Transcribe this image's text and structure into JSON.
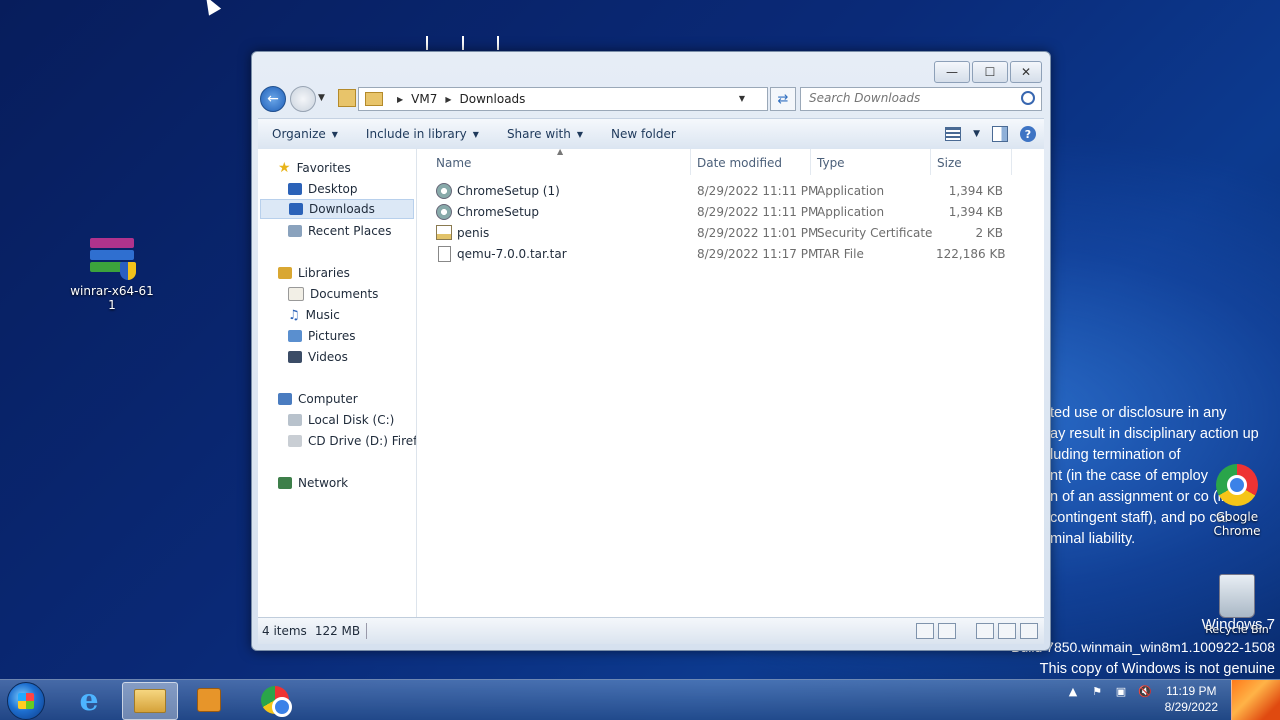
{
  "desktop": {
    "icons": {
      "winrar": "winrar-x64-611",
      "winrar_line1": "winrar-x64-61",
      "winrar_line2": "1",
      "chrome_line1": "Google",
      "chrome_line2": "Chrome",
      "recycle": "Recycle Bin"
    },
    "disclaimer": [
      "ted use or disclosure in any",
      "ay result in disciplinary action up",
      "luding termination of",
      "nt (in the case of employ",
      "n of an assignment or co  (in",
      " contingent staff), and po  cal",
      "minal liability."
    ],
    "watermark": {
      "line1": "Windows 7",
      "line2": "Build 7850.winmain_win8m1.100922-1508",
      "line3": "This copy of Windows is not genuine"
    }
  },
  "explorer": {
    "caption": {
      "minimize": "—",
      "maximize": "☐",
      "close": "✕"
    },
    "address": {
      "root": "VM7",
      "current": "Downloads"
    },
    "search": {
      "placeholder": "Search Downloads"
    },
    "toolbar": {
      "organize": "Organize",
      "include": "Include in library",
      "share": "Share with",
      "newfolder": "New folder"
    },
    "nav": {
      "favorites": "Favorites",
      "desktop": "Desktop",
      "downloads": "Downloads",
      "recent": "Recent Places",
      "libraries": "Libraries",
      "documents": "Documents",
      "music": "Music",
      "pictures": "Pictures",
      "videos": "Videos",
      "computer": "Computer",
      "localdisk": "Local Disk (C:)",
      "cddrive": "CD Drive (D:) Firefox",
      "network": "Network"
    },
    "columns": {
      "name": "Name",
      "date": "Date modified",
      "type": "Type",
      "size": "Size"
    },
    "files": [
      {
        "name": "ChromeSetup (1)",
        "date": "8/29/2022 11:11 PM",
        "type": "Application",
        "size": "1,394 KB"
      },
      {
        "name": "ChromeSetup",
        "date": "8/29/2022 11:11 PM",
        "type": "Application",
        "size": "1,394 KB"
      },
      {
        "name": "penis",
        "date": "8/29/2022 11:01 PM",
        "type": "Security Certificate",
        "size": "2 KB"
      },
      {
        "name": "qemu-7.0.0.tar.tar",
        "date": "8/29/2022 11:17 PM",
        "type": "TAR File",
        "size": "122,186 KB"
      }
    ],
    "status": {
      "items": "4 items",
      "size": "122 MB"
    }
  },
  "taskbar": {
    "clock": {
      "time": "11:19 PM",
      "date": "8/29/2022"
    }
  }
}
